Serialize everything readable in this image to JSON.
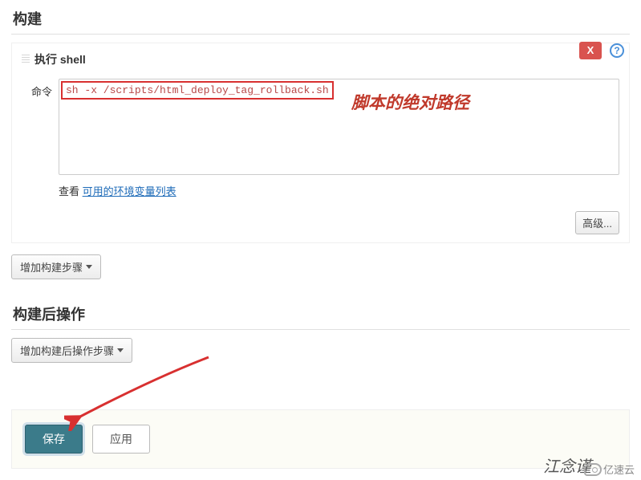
{
  "build": {
    "title": "构建",
    "shell_header": "执行 shell",
    "cmd_label": "命令",
    "cmd_value": "sh -x /scripts/html_deploy_tag_rollback.sh",
    "annotation": "脚本的绝对路径",
    "see_prefix": "查看 ",
    "see_link": "可用的环境变量列表",
    "advanced_btn": "高级...",
    "add_step_btn": "增加构建步骤",
    "close_x": "X",
    "help_q": "?"
  },
  "post": {
    "title": "构建后操作",
    "add_step_btn": "增加构建后操作步骤"
  },
  "footer": {
    "save": "保存",
    "apply": "应用"
  },
  "watermark": "江念谨",
  "brand": "亿速云"
}
